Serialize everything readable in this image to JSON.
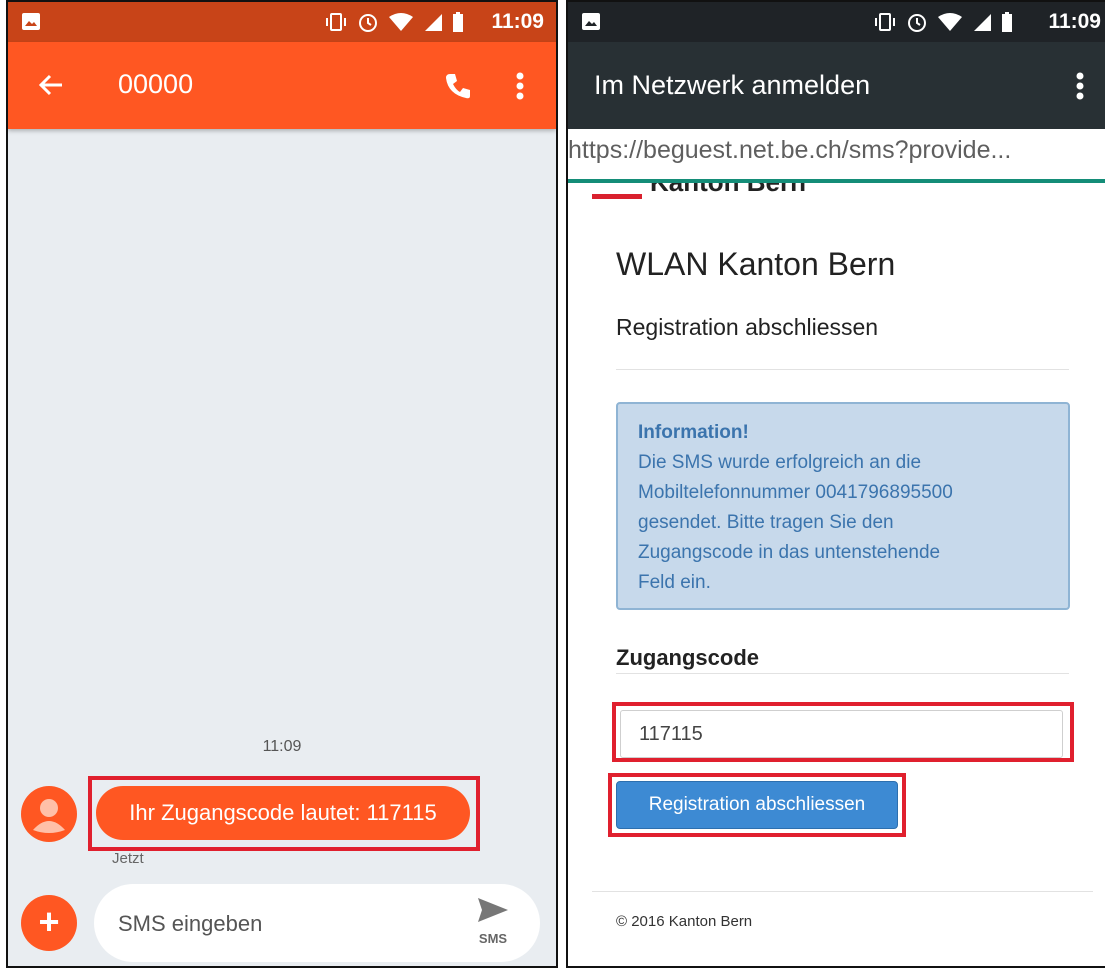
{
  "left_phone": {
    "status_bar": {
      "time": "11:09"
    },
    "app_bar": {
      "title": "00000",
      "icons": [
        "back-arrow-icon",
        "phone-icon",
        "more-vert-icon"
      ]
    },
    "conversation": {
      "timestamp": "11:09",
      "message": "Ihr Zugangscode lautet: 117115",
      "message_meta": "Jetzt"
    },
    "compose": {
      "placeholder": "SMS eingeben",
      "send_label": "SMS"
    }
  },
  "right_phone": {
    "status_bar": {
      "time": "11:09"
    },
    "app_bar": {
      "title": "Im Netzwerk anmelden"
    },
    "url": "https://beguest.net.be.ch/sms?provide...",
    "page": {
      "logo_text": "Kanton Bern",
      "title": "WLAN Kanton Bern",
      "subtitle": "Registration abschliessen",
      "info_title": "Information!",
      "info_lines": [
        "Die SMS wurde erfolgreich an die",
        "Mobiltelefonnummer 0041796895500",
        "gesendet. Bitte tragen Sie den",
        "Zugangscode in das untenstehende",
        "Feld ein."
      ],
      "field_label": "Zugangscode",
      "field_value": "117115",
      "button_label": "Registration abschliessen",
      "footer": "© 2016 Kanton Bern"
    }
  },
  "colors": {
    "accent_orange": "#ff5722",
    "status_orange": "#c84418",
    "dark_bar": "#283034",
    "highlight_red": "#e0202e",
    "button_blue": "#3d8ad3",
    "info_blue": "#c7d9eb",
    "url_underline": "#148d78"
  }
}
